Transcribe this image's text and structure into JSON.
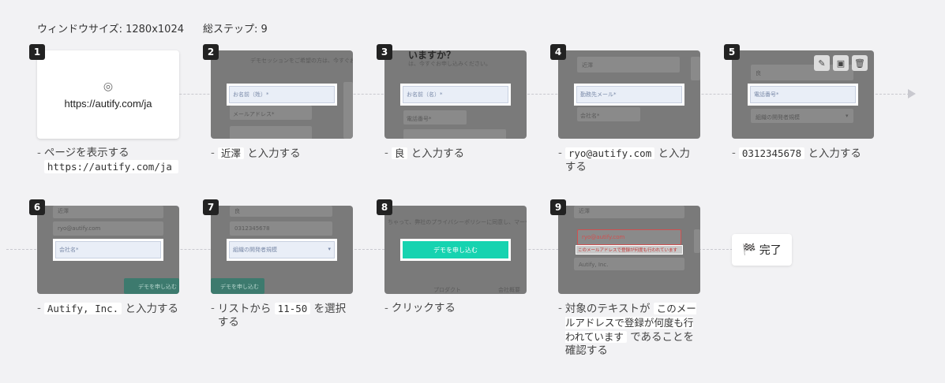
{
  "header": {
    "window_size": "ウィンドウサイズ: 1280x1024",
    "total_steps": "総ステップ: 9"
  },
  "steps": [
    {
      "num": "1",
      "url": "https://autify.com/ja",
      "desc_pre": "ページを表示する",
      "code": "https://autify.com/ja",
      "desc_post": ""
    },
    {
      "num": "2",
      "field_placeholder": "お名前（姓）*",
      "desc_pre": "",
      "code": "近澤",
      "desc_post": "と入力する",
      "ghost_title": "",
      "ghost_sub": "デモセッションをご希望の方は、今すぐお申し込みください。",
      "ghost_field2": "メールアドレス*"
    },
    {
      "num": "3",
      "field_placeholder": "お名前（名）*",
      "desc_pre": "",
      "code": "良",
      "desc_post": "と入力する",
      "ghost_title": "いますか？",
      "ghost_sub": "は、今すぐお申し込みください。",
      "ghost_field2": "電話番号*"
    },
    {
      "num": "4",
      "field_placeholder": "勤務先メール*",
      "desc_pre": "",
      "code": "ryo@autify.com",
      "desc_post": "と入力する",
      "ghost_top": "近澤",
      "ghost_field2": "会社名*"
    },
    {
      "num": "5",
      "field_placeholder": "電話番号*",
      "desc_pre": "",
      "code": "0312345678",
      "desc_post": "と入力する",
      "ghost_top": "良",
      "ghost_field2": "組織の開発者規模"
    },
    {
      "num": "6",
      "field_placeholder": "会社名*",
      "desc_pre": "",
      "code": "Autify, Inc.",
      "desc_post": "と入力する",
      "ghost_top": "近澤",
      "ghost_field_top2": "ryo@autify.com",
      "ghost_btn": "デモを申し込む"
    },
    {
      "num": "7",
      "field_placeholder": "組織の開発者規模",
      "desc_pre": "リストから",
      "code": "11-50",
      "desc_post": "を選択する",
      "ghost_top": "良",
      "ghost_field_top2": "0312345678",
      "ghost_btn": "デモを申し込む"
    },
    {
      "num": "8",
      "button_label": "デモを申し込む",
      "desc_pre": "クリックする",
      "code": "",
      "desc_post": "",
      "ghost_sub": "ちゃって、弊社のプライバシーポリシーに同意し、マーケティ",
      "ghost_foot_left": "プロダクト",
      "ghost_foot_right": "会社概要"
    },
    {
      "num": "9",
      "error_value": "ryo@autify.com",
      "error_msg": "このメールアドレスで登録が何度も行われています",
      "desc_pre": "対象のテキストが",
      "code": "このメールアドレスで登録が何度も行われています",
      "desc_post": "であることを確認する",
      "ghost_top": "近澤",
      "ghost_company": "Autify, Inc."
    }
  ],
  "done": {
    "label": "完了"
  },
  "toolbar": {
    "edit": "edit-icon",
    "image": "image-icon",
    "delete": "trash-icon"
  },
  "colors": {
    "accent": "#16b6a0",
    "badge": "#222222",
    "error": "#e04040"
  }
}
